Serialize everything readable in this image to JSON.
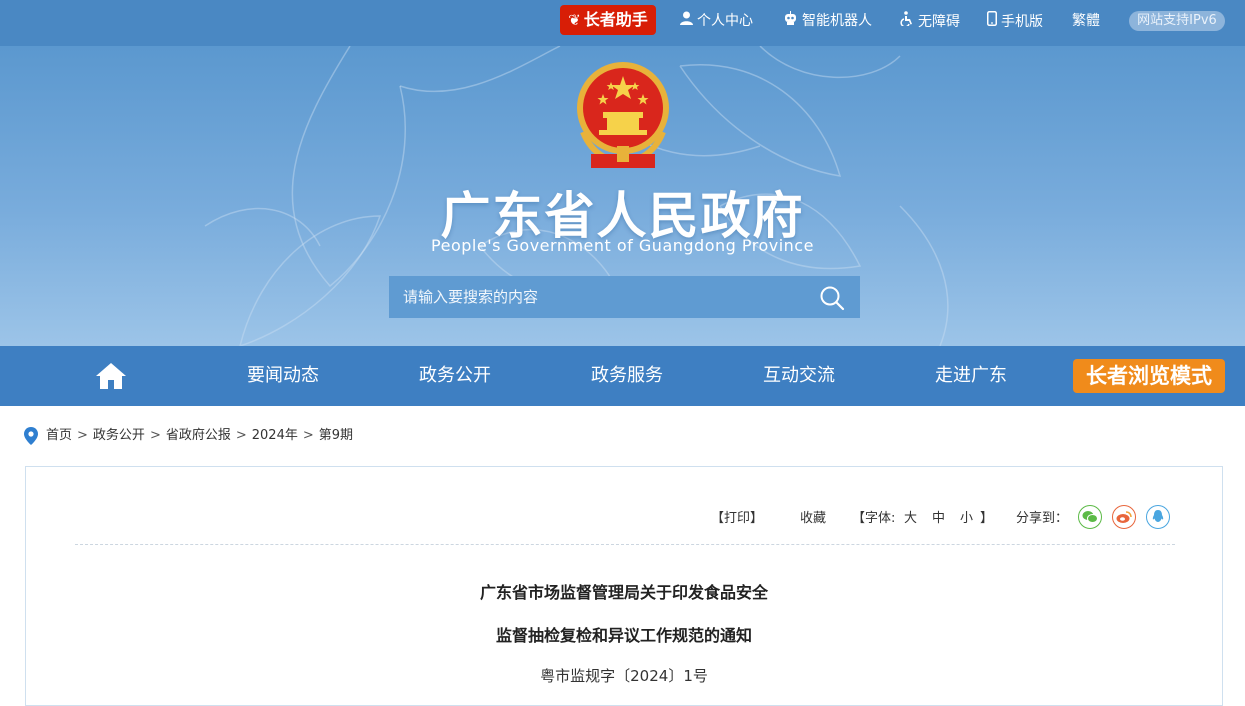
{
  "topbar": {
    "elder_assist": "长者助手",
    "links": [
      {
        "label": "个人中心",
        "icon": "user-icon"
      },
      {
        "label": "智能机器人",
        "icon": "robot-icon"
      },
      {
        "label": "无障碍",
        "icon": "accessibility-icon"
      },
      {
        "label": "手机版",
        "icon": "mobile-icon"
      },
      {
        "label": "繁體",
        "icon": ""
      }
    ],
    "ipv6": "网站支持IPv6"
  },
  "banner": {
    "title": "广东省人民政府",
    "subtitle": "People's Government of Guangdong Province",
    "search_placeholder": "请输入要搜索的内容"
  },
  "nav": {
    "items": [
      "要闻动态",
      "政务公开",
      "政务服务",
      "互动交流",
      "走进广东"
    ],
    "elder_mode": "长者浏览模式"
  },
  "breadcrumb": [
    "首页",
    "政务公开",
    "省政府公报",
    "2024年",
    "第9期"
  ],
  "toolbar": {
    "print": "【打印】",
    "favorite": "收藏",
    "font_label": "【字体:",
    "font_large": "大",
    "font_medium": "中",
    "font_small": "小",
    "font_close": "】",
    "share_label": "分享到：",
    "share_icons": [
      "wechat-icon",
      "weibo-icon",
      "qq-icon"
    ]
  },
  "document": {
    "title_line1": "广东省市场监督管理局关于印发食品安全",
    "title_line2": "监督抽检复检和异议工作规范的通知",
    "doc_number": "粤市监规字〔2024〕1号"
  },
  "colors": {
    "topbar": "#4a88c3",
    "nav": "#3e7fc2",
    "elder_assist": "#d81e06",
    "elder_mode": "#f08b1b"
  }
}
